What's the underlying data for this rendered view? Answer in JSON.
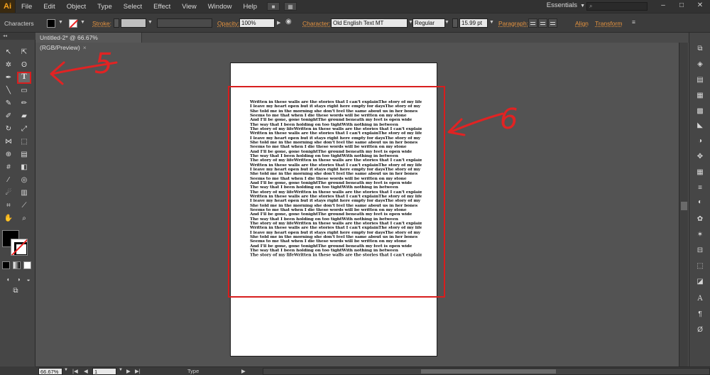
{
  "app": {
    "logo": "Ai"
  },
  "menubar": {
    "items": [
      "File",
      "Edit",
      "Object",
      "Type",
      "Select",
      "Effect",
      "View",
      "Window",
      "Help"
    ],
    "workspace": "Essentials",
    "search_placeholder": "",
    "window_buttons": [
      "–",
      "□",
      "✕"
    ]
  },
  "controlbar": {
    "panel_label": "Characters",
    "stroke_label": "Stroke:",
    "opacity_label": "Opacity:",
    "opacity_value": "100%",
    "character_label": "Character:",
    "font_family": "Old English Text MT",
    "font_style": "Regular",
    "font_size": "15.99 pt",
    "paragraph_label": "Paragraph:",
    "align_label": "Align",
    "transform_label": "Transform"
  },
  "document": {
    "tab_title": "Untitled-2* @ 66.67% (RGB/Preview)",
    "tab_close": "×",
    "lines": [
      "Written in these walls are the stories that I can't explainThe story of my life",
      "I leave my heart open but it stays right here empty for daysThe story of my life",
      "She told me in the morning she don't feel the same about us in her bones",
      "Seems to me that when I die these words will be written on my stone",
      "And I'll be gone, gone tonightThe ground beneath my feet is open wide",
      "The way that I been holding on too tightWith nothing in between",
      "The story of my lifeWritten in these walls are the stories that I can't explain",
      "Written in these walls are the stories that I can't explainThe story of my life",
      "I leave my heart open but it stays right here empty for daysThe story of my life",
      "She told me in the morning she don't feel the same about us in her bones",
      "Seems to me that when I die these words will be written on my stone",
      "And I'll be gone, gone tonightThe ground beneath my feet is open wide",
      "The way that I been holding on too tightWith nothing in between",
      "The story of my lifeWritten in these walls are the stories that I can't explain",
      "Written in these walls are the stories that I can't explainThe story of my life",
      "I leave my heart open but it stays right here empty for daysThe story of my life",
      "She told me in the morning she don't feel the same about us in her bones",
      "Seems to me that when I die these words will be written on my stone",
      "And I'll be gone, gone tonightThe ground beneath my feet is open wide",
      "The way that I been holding on too tightWith nothing in between",
      "The story of my lifeWritten in these walls are the stories that I can't explain",
      "Written in these walls are the stories that I can't explainThe story of my life",
      "I leave my heart open but it stays right here empty for daysThe story of my life",
      "She told me in the morning she don't feel the same about us in her bones",
      "Seems to me that when I die these words will be written on my stone",
      "And I'll be gone, gone tonightThe ground beneath my feet is open wide",
      "The way that I been holding on too tightWith nothing in between",
      "The story of my lifeWritten in these walls are the stories that I can't explain",
      "Written in these walls are the stories that I can't explainThe story of my life",
      "I leave my heart open but it stays right here empty for daysThe story of my life",
      "She told me in the morning she don't feel the same about us in her bones",
      "Seems to me that when I die these words will be written on my stone",
      "And I'll be gone, gone tonightThe ground beneath my feet is open wide",
      "The way that I been holding on too tightWith nothing in between",
      "The story of my lifeWritten in these walls are the stories that I can't explain"
    ]
  },
  "annotations": {
    "type_tool_number": "5",
    "text_area_number": "6",
    "color": "#d81e1e"
  },
  "statusbar": {
    "zoom": "66.67%",
    "page": "1",
    "current_tool": "Type"
  },
  "colors": {
    "accent": "#e5933f",
    "panel": "#464646",
    "canvas_bg": "#535353"
  }
}
